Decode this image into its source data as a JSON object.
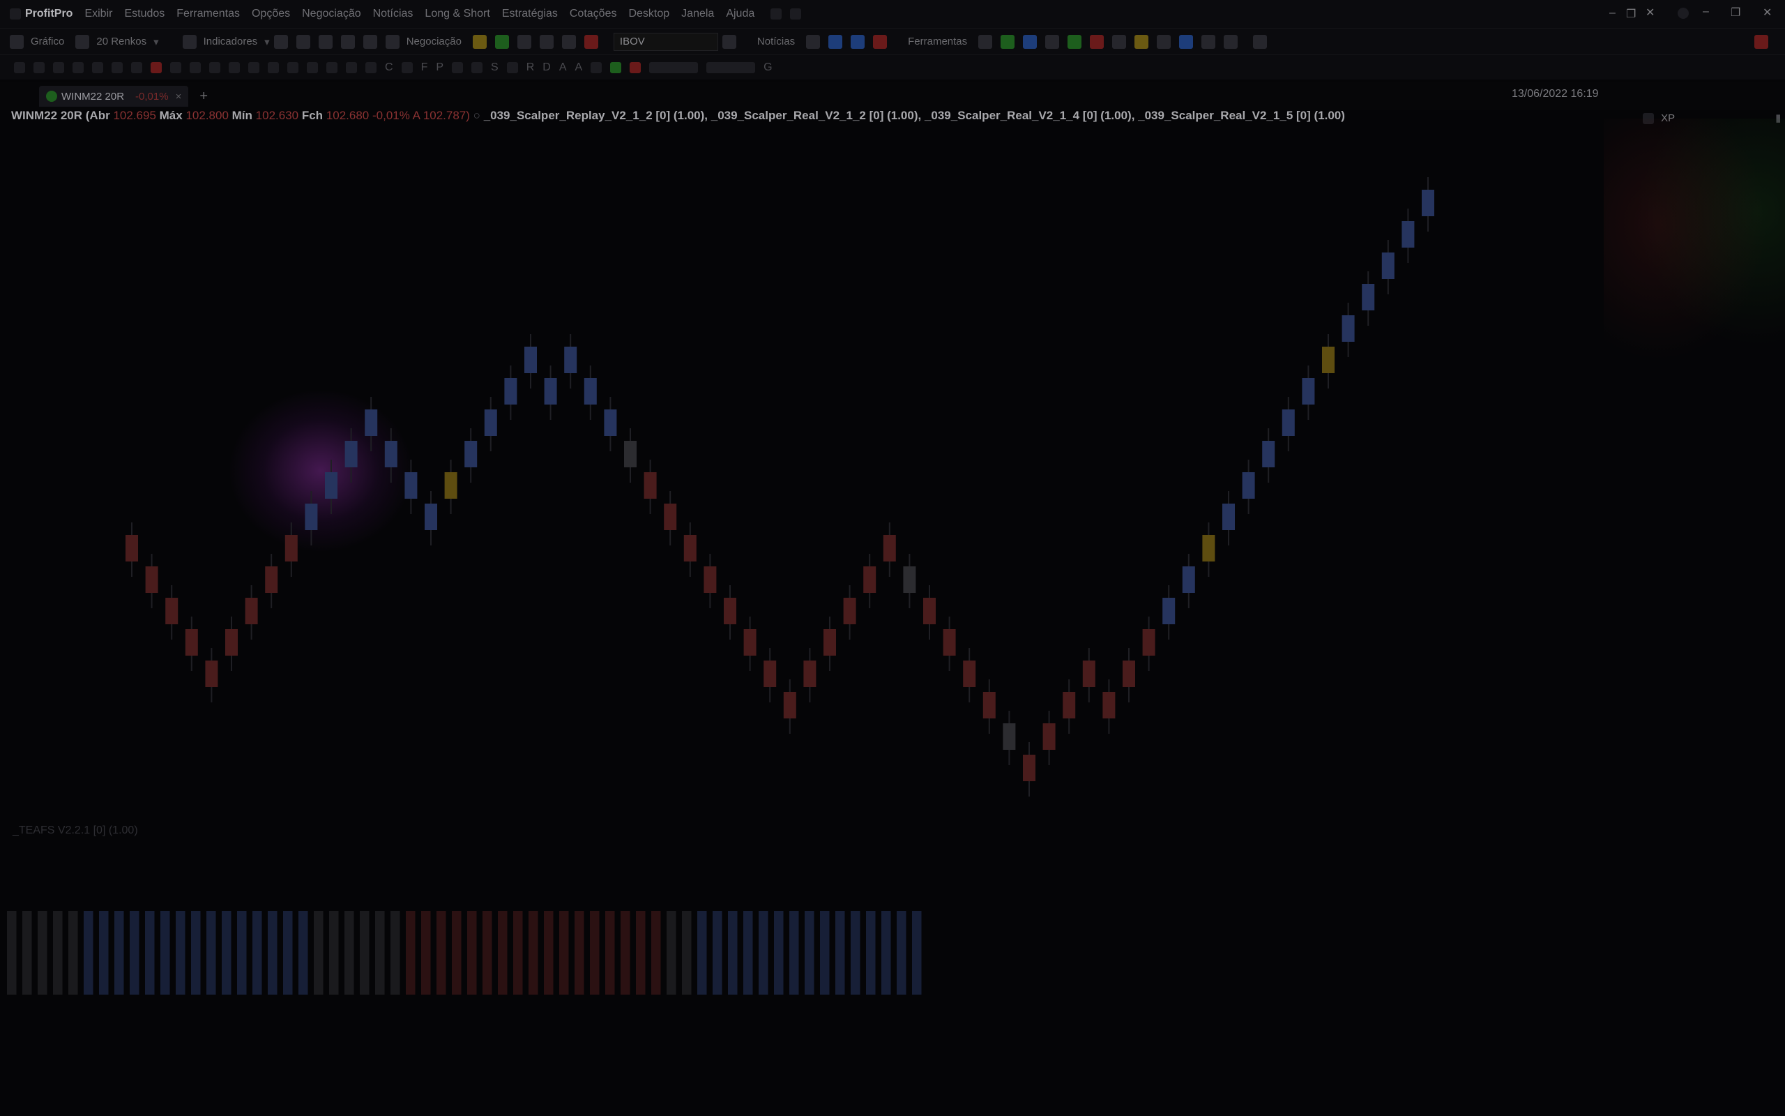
{
  "app": {
    "name": "ProfitPro",
    "menu": [
      "Exibir",
      "Estudos",
      "Ferramentas",
      "Opções",
      "Negociação",
      "Notícias",
      "Long & Short",
      "Estratégias",
      "Cotações",
      "Desktop",
      "Janela",
      "Ajuda"
    ]
  },
  "toolbar": {
    "chart_label": "Gráfico",
    "renko_label": "20 Renkos",
    "indicators_label": "Indicadores",
    "trading_label": "Negociação",
    "symbol_select": "IBOV",
    "news_label": "Notícias",
    "tools_label": "Ferramentas"
  },
  "drawing_letters": [
    "C",
    "F",
    "P",
    "S",
    "R",
    "D",
    "A",
    "A",
    "G"
  ],
  "tab": {
    "symbol": "WINM22 20R",
    "change": "-0,01%",
    "close_glyph": "×",
    "add_glyph": "+"
  },
  "chart_header": {
    "symbol": "WINM22 20R",
    "open_label": "(Abr",
    "open": "102.695",
    "high_label": "Máx",
    "high": "102.800",
    "low_label": "Mín",
    "low": "102.630",
    "close_label": "Fch",
    "close": "102.680",
    "change": "-0,01%",
    "avg_label": "A",
    "avg": "102.787)",
    "studies": "_039_Scalper_Replay_V2_1_2 [0] (1.00), _039_Scalper_Real_V2_1_2 [0] (1.00), _039_Scalper_Real_V2_1_4 [0] (1.00), _039_Scalper_Real_V2_1_5 [0] (1.00)"
  },
  "timestamp": "13/06/2022 16:19",
  "account": "XP",
  "subchart_label": "_TEAFS V2.2.1 [0] (1.00)",
  "colors": {
    "bull": "#26345e",
    "bear": "#4a1c1c",
    "signal": "#5e4d10",
    "neutral": "#2c2c30"
  },
  "chart_data": {
    "type": "renko",
    "brick_size": 20,
    "last_close": 102680,
    "bricks": [
      {
        "dir": "down",
        "color": "bear"
      },
      {
        "dir": "down",
        "color": "bear"
      },
      {
        "dir": "down",
        "color": "bear"
      },
      {
        "dir": "down",
        "color": "bear"
      },
      {
        "dir": "down",
        "color": "bear"
      },
      {
        "dir": "up",
        "color": "bear"
      },
      {
        "dir": "up",
        "color": "bear"
      },
      {
        "dir": "up",
        "color": "bear"
      },
      {
        "dir": "up",
        "color": "bear"
      },
      {
        "dir": "up",
        "color": "bull"
      },
      {
        "dir": "up",
        "color": "bull"
      },
      {
        "dir": "up",
        "color": "bull"
      },
      {
        "dir": "up",
        "color": "bull"
      },
      {
        "dir": "down",
        "color": "bull"
      },
      {
        "dir": "down",
        "color": "bull"
      },
      {
        "dir": "down",
        "color": "bull"
      },
      {
        "dir": "up",
        "color": "signal"
      },
      {
        "dir": "up",
        "color": "bull"
      },
      {
        "dir": "up",
        "color": "bull"
      },
      {
        "dir": "up",
        "color": "bull"
      },
      {
        "dir": "up",
        "color": "bull"
      },
      {
        "dir": "down",
        "color": "bull"
      },
      {
        "dir": "up",
        "color": "bull"
      },
      {
        "dir": "down",
        "color": "bull"
      },
      {
        "dir": "down",
        "color": "bull"
      },
      {
        "dir": "down",
        "color": "neutral"
      },
      {
        "dir": "down",
        "color": "bear"
      },
      {
        "dir": "down",
        "color": "bear"
      },
      {
        "dir": "down",
        "color": "bear"
      },
      {
        "dir": "down",
        "color": "bear"
      },
      {
        "dir": "down",
        "color": "bear"
      },
      {
        "dir": "down",
        "color": "bear"
      },
      {
        "dir": "down",
        "color": "bear"
      },
      {
        "dir": "down",
        "color": "bear"
      },
      {
        "dir": "up",
        "color": "bear"
      },
      {
        "dir": "up",
        "color": "bear"
      },
      {
        "dir": "up",
        "color": "bear"
      },
      {
        "dir": "up",
        "color": "bear"
      },
      {
        "dir": "up",
        "color": "bear"
      },
      {
        "dir": "down",
        "color": "neutral"
      },
      {
        "dir": "down",
        "color": "bear"
      },
      {
        "dir": "down",
        "color": "bear"
      },
      {
        "dir": "down",
        "color": "bear"
      },
      {
        "dir": "down",
        "color": "bear"
      },
      {
        "dir": "down",
        "color": "neutral"
      },
      {
        "dir": "down",
        "color": "bear"
      },
      {
        "dir": "up",
        "color": "bear"
      },
      {
        "dir": "up",
        "color": "bear"
      },
      {
        "dir": "up",
        "color": "bear"
      },
      {
        "dir": "down",
        "color": "bear"
      },
      {
        "dir": "up",
        "color": "bear"
      },
      {
        "dir": "up",
        "color": "bear"
      },
      {
        "dir": "up",
        "color": "bull"
      },
      {
        "dir": "up",
        "color": "bull"
      },
      {
        "dir": "up",
        "color": "signal"
      },
      {
        "dir": "up",
        "color": "bull"
      },
      {
        "dir": "up",
        "color": "bull"
      },
      {
        "dir": "up",
        "color": "bull"
      },
      {
        "dir": "up",
        "color": "bull"
      },
      {
        "dir": "up",
        "color": "bull"
      },
      {
        "dir": "up",
        "color": "signal"
      },
      {
        "dir": "up",
        "color": "bull"
      },
      {
        "dir": "up",
        "color": "bull"
      },
      {
        "dir": "up",
        "color": "bull"
      },
      {
        "dir": "up",
        "color": "bull"
      },
      {
        "dir": "up",
        "color": "bull"
      }
    ],
    "histogram_colors": [
      "neutral",
      "neutral",
      "neutral",
      "neutral",
      "neutral",
      "bull",
      "bull",
      "bull",
      "bull",
      "bull",
      "bull",
      "bull",
      "bull",
      "bull",
      "bull",
      "bull",
      "bull",
      "bull",
      "bull",
      "bull",
      "neutral",
      "neutral",
      "neutral",
      "neutral",
      "neutral",
      "neutral",
      "bear",
      "bear",
      "bear",
      "bear",
      "bear",
      "bear",
      "bear",
      "bear",
      "bear",
      "bear",
      "bear",
      "bear",
      "bear",
      "bear",
      "bear",
      "bear",
      "bear",
      "neutral",
      "neutral",
      "bull",
      "bull",
      "bull",
      "bull",
      "bull",
      "bull",
      "bull",
      "bull",
      "bull",
      "bull",
      "bull",
      "bull",
      "bull",
      "bull",
      "bull"
    ]
  }
}
